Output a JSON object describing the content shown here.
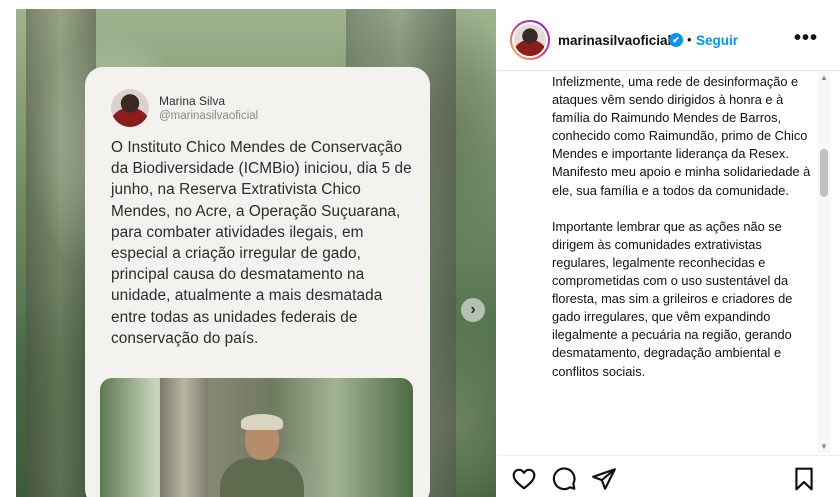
{
  "post": {
    "card": {
      "name": "Marina Silva",
      "handle": "@marinasilvaoficial",
      "text": "O Instituto Chico Mendes de Conservação da Biodiversidade (ICMBio) iniciou, dia 5 de junho, na Reserva Extrativista Chico Mendes, no Acre, a Operação Suçuarana, para combater atividades ilegais, em especial a criação irregular de gado, principal causa do desmatamento na unidade, atualmente a mais desmatada entre todas as unidades federais de conservação do país."
    },
    "next_icon": "›"
  },
  "header": {
    "username": "marinasilvaoficial",
    "verified_icon": "✔",
    "separator": "•",
    "follow_label": "Seguir",
    "more_icon": "•••"
  },
  "caption": {
    "p1": "Infelizmente, uma rede de desinformação e ataques vêm sendo dirigidos à honra e à família do Raimundo Mendes de Barros, conhecido como Raimundão, primo de Chico Mendes e importante liderança da Resex.",
    "p2": "Manifesto meu apoio e minha solidariedade à ele, sua família e a todos da comunidade.",
    "p3": "Importante lembrar que as ações não se dirigem às comunidades extrativistas regulares, legalmente reconhecidas e comprometidas com o uso sustentável da floresta, mas sim a grileiros e criadores de gado irregulares, que vêm expandindo ilegalmente a pecuária na região, gerando desmatamento, degradação ambiental e conflitos sociais."
  },
  "scrollbar": {
    "up_icon": "▲",
    "down_icon": "▼",
    "scroll_position": 0.2
  },
  "actions": {
    "like_icon": "heart-icon",
    "comment_icon": "comment-icon",
    "share_icon": "share-icon",
    "save_icon": "bookmark-icon"
  }
}
